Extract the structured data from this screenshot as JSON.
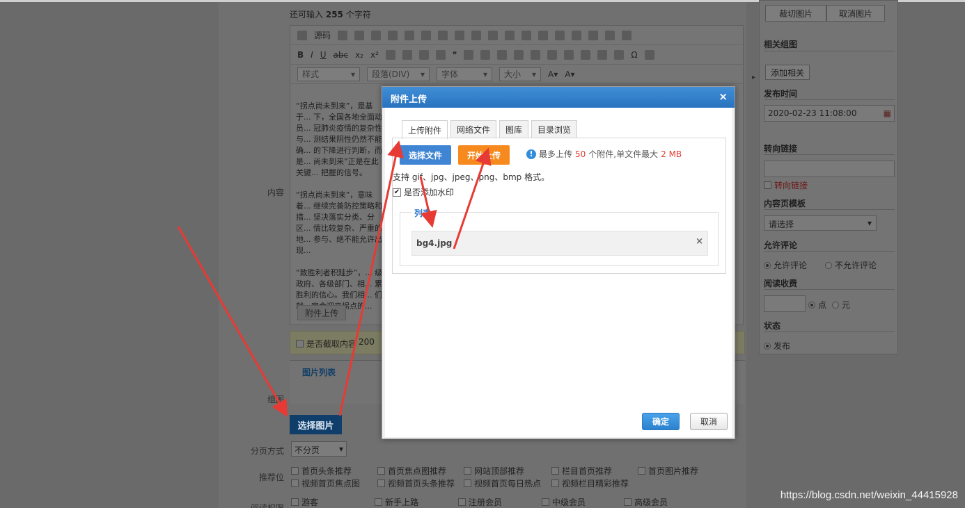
{
  "page": {
    "remaining_chars_prefix": "还可输入",
    "remaining_chars_count": "255",
    "remaining_chars_suffix": "个字符",
    "content_label": "内容",
    "toolbar": {
      "source": "源码",
      "style": "样式",
      "paragraph": "段落(DIV)",
      "font": "字体",
      "size": "大小"
    },
    "editor_paragraphs": [
      "“拐点尚未到来”，是基于... 下，全国各地全面动员... 冠肺炎疫情的复杂性与... 测结果阴性仍然不能确... 的下降进行判断，而是... 尚未到来”正是在此关键... 把握的信号。",
      "“拐点尚未到来”，意味着... 继续完善防控策略和措... 坚决落实分类、分区... 情比较复杂、严重的地... 参与、绝不能允许出现...",
      "“致胜利者积跬步”，... 级政府、各级部门、相... 累胜利的信心。我们相... 们就一定会迎来拐点的..."
    ],
    "editor_footer": "附件上传",
    "truncate_label": "是否截取内容",
    "truncate_value": "200",
    "image_list_title": "图片列表",
    "group_image_label": "组图",
    "select_image_button": "选择图片",
    "paging_label": "分页方式",
    "paging_value": "不分页",
    "recommend_label": "推荐位",
    "recommend_row1": [
      "首页头条推荐",
      "首页焦点图推荐",
      "网站顶部推荐",
      "栏目首页推荐",
      "首页图片推荐"
    ],
    "recommend_row2": [
      "视频首页焦点图",
      "视频首页头条推荐",
      "视频首页每日热点",
      "视频栏目精彩推荐"
    ],
    "read_perm_label": "阅读权限",
    "read_perm_options": [
      "游客",
      "新手上路",
      "注册会员",
      "中级会员",
      "高级会员"
    ]
  },
  "right_panel": {
    "crop_button": "裁切图片",
    "cancel_image_button": "取消图片",
    "related_title": "相关组图",
    "add_related_button": "添加相关",
    "publish_time_title": "发布时间",
    "publish_time_value": "2020-02-23 11:08:00",
    "redirect_title": "转向链接",
    "redirect_checkbox": "转向链接",
    "template_title": "内容页模板",
    "template_value": "请选择",
    "comment_title": "允许评论",
    "comment_allow": "允许评论",
    "comment_deny": "不允许评论",
    "charge_title": "阅读收费",
    "charge_unit_points": "点",
    "charge_unit_yuan": "元",
    "status_title": "状态",
    "status_publish": "发布"
  },
  "dialog": {
    "title": "附件上传",
    "tabs": [
      "上传附件",
      "网络文件",
      "图库",
      "目录浏览"
    ],
    "select_file_button": "选择文件",
    "start_upload_button": "开始上传",
    "limit_prefix": "最多上传",
    "limit_count": "50",
    "limit_mid": "个附件,单文件最大",
    "limit_size": "2 MB",
    "formats_text": "支持 gif、jpg、jpeg、png、bmp 格式。",
    "watermark_checkbox": "是否添加水印",
    "list_legend": "列表",
    "files": [
      "bg4.jpg"
    ],
    "ok_button": "确定",
    "cancel_button": "取消"
  },
  "watermark": "https://blog.csdn.net/weixin_44415928",
  "colors": {
    "dialog_header": "#2a73bf",
    "accent_blue": "#3f85d3",
    "accent_orange": "#f68a1f",
    "limit_red": "#e23b32",
    "arrow_red": "#e83a34"
  }
}
